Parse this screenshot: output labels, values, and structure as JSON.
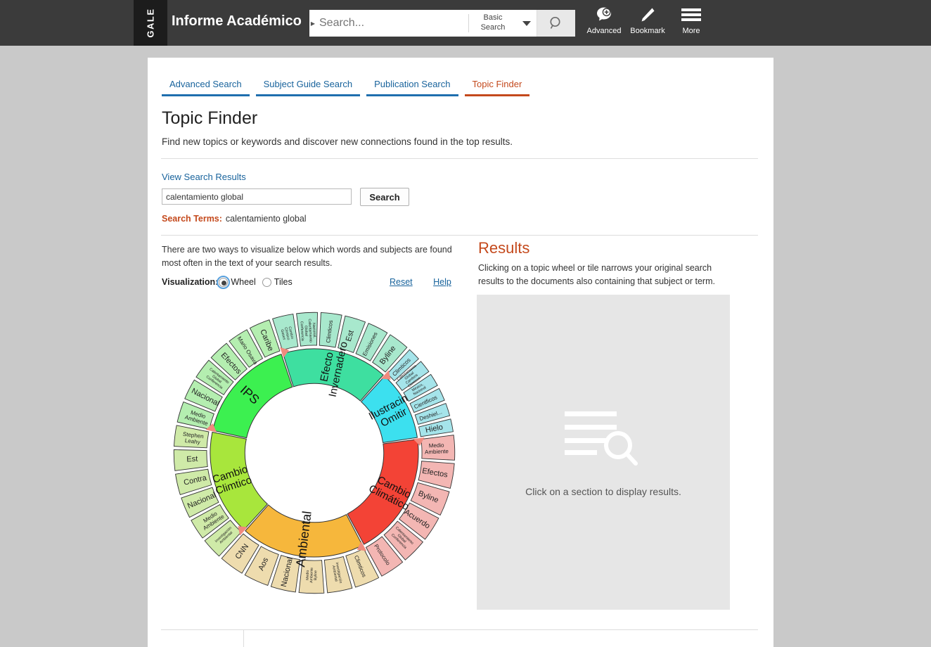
{
  "header": {
    "logo_text": "GALE",
    "app_title": "Informe Académico",
    "search_placeholder": "Search...",
    "search_value": "",
    "search_mode_line1": "Basic",
    "search_mode_line2": "Search",
    "icons": [
      {
        "name": "advanced-icon",
        "label": "Advanced"
      },
      {
        "name": "bookmark-icon",
        "label": "Bookmark"
      },
      {
        "name": "more-icon",
        "label": "More"
      }
    ]
  },
  "tabs": [
    {
      "label": "Advanced Search",
      "active": false
    },
    {
      "label": "Subject Guide Search",
      "active": false
    },
    {
      "label": "Publication Search",
      "active": false
    },
    {
      "label": "Topic Finder",
      "active": true
    }
  ],
  "page": {
    "title": "Topic Finder",
    "subtitle": "Find new topics or keywords and discover new connections found in the top results.",
    "view_results_link": "View Search Results",
    "query_value": "calentamiento global",
    "query_placeholder": "",
    "search_button": "Search",
    "search_terms_label": "Search Terms:",
    "search_terms_value": "calentamiento global",
    "visualization_blurb": "There are two ways to visualize below which words and subjects are found most often in the text of your search results.",
    "visualization_label": "Visualization:",
    "option_wheel": "Wheel",
    "option_tiles": "Tiles",
    "selected_visualization": "Wheel",
    "reset_link": "Reset",
    "help_link": "Help"
  },
  "results": {
    "title": "Results",
    "description": "Clicking on a topic wheel or tile narrows your original search results to the documents also containing that subject or term.",
    "empty_state": "Click on a section to display results.",
    "empty_icon": "list-search-icon"
  },
  "colors": {
    "accent_orange": "#c4491c",
    "link_blue": "#18639c",
    "header_dark": "#3b3b3b",
    "panel_gray": "#e6e6e6",
    "marker_salmon": "#f08a7e"
  },
  "chart_data": {
    "type": "pie",
    "title": "Topic Finder wheel for \"calentamiento global\"",
    "layout": "two-ring sunburst; inner ring = 6 topics, outer ring = 6 sub-terms each",
    "inner_radius": 0.42,
    "mid_radius": 0.63,
    "outer_radius": 0.85,
    "segments": [
      {
        "label": "IPS",
        "color": "#3cf050",
        "outer_color": "#b4eeb0",
        "start_angle": -78,
        "end_angle": -18,
        "children": [
          "Medio Ambiente",
          "Nacional",
          "Calentamiento Global Conferencia",
          "Efectos",
          "Mario Osava",
          "Caribe"
        ]
      },
      {
        "label": "Efecto Invernadero",
        "color": "#3edfa0",
        "outer_color": "#a8e8cd",
        "start_angle": -18,
        "end_angle": 42,
        "children": [
          "Cambio Climtico Gases",
          "Nacional, Calentamiento Global Conferencia",
          "Climticos",
          "Est",
          "Emisiones",
          "Byline"
        ]
      },
      {
        "label": "Ilustracin Omitir",
        "color": "#3ce0ef",
        "outer_color": "#a5e4ea",
        "start_angle": 42,
        "end_angle": 82,
        "children": [
          "Climticos",
          "Calentamiento Global Cambios Climticos",
          "México, Nacional",
          "Cientficos",
          "Deshiel...",
          "Hielo"
        ]
      },
      {
        "label": "Cambio Climático",
        "color": "#f34336",
        "outer_color": "#f3b6b3",
        "start_angle": 82,
        "end_angle": 152,
        "children": [
          "Medio Ambiente",
          "Efectos",
          "Byline",
          "Acuerdo",
          "Calentamiento Global Conferencia",
          "Protocolo"
        ]
      },
      {
        "label": "Ambiental",
        "color": "#f6b73c",
        "outer_color": "#eedcae",
        "start_angle": 152,
        "end_angle": 222,
        "children": [
          "Climticos",
          "Investigación Ambiental",
          "Medio Ambiente Byline",
          "Nacional",
          "Aos",
          "CNN"
        ]
      },
      {
        "label": "Cambio Climtico",
        "color": "#a8e63c",
        "outer_color": "#cfeaa8",
        "start_angle": 222,
        "end_angle": 282,
        "children": [
          "Investigación Ambiental",
          "Medio Ambiente",
          "Nacional",
          "Contra",
          "Est",
          "Stephen Leahy"
        ]
      }
    ]
  }
}
